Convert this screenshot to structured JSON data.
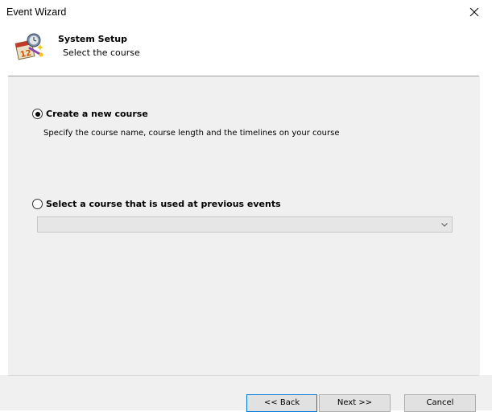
{
  "window": {
    "title": "Event Wizard"
  },
  "header": {
    "title": "System Setup",
    "subtitle": "Select the course"
  },
  "options": {
    "new_course": {
      "label": "Create a new course",
      "description": "Specify the course name, course length and the timelines on your course",
      "selected": true
    },
    "previous_course": {
      "label": "Select a course that is used at previous events",
      "selected": false,
      "dropdown_value": ""
    }
  },
  "buttons": {
    "back": "<< Back",
    "next": "Next >>",
    "cancel": "Cancel"
  },
  "icons": {
    "close": "close-icon",
    "wizard": "calendar-wizard-icon",
    "dropdown": "chevron-down-icon"
  },
  "colors": {
    "content_bg": "#f0f0f0",
    "focus_border": "#0078d7"
  }
}
